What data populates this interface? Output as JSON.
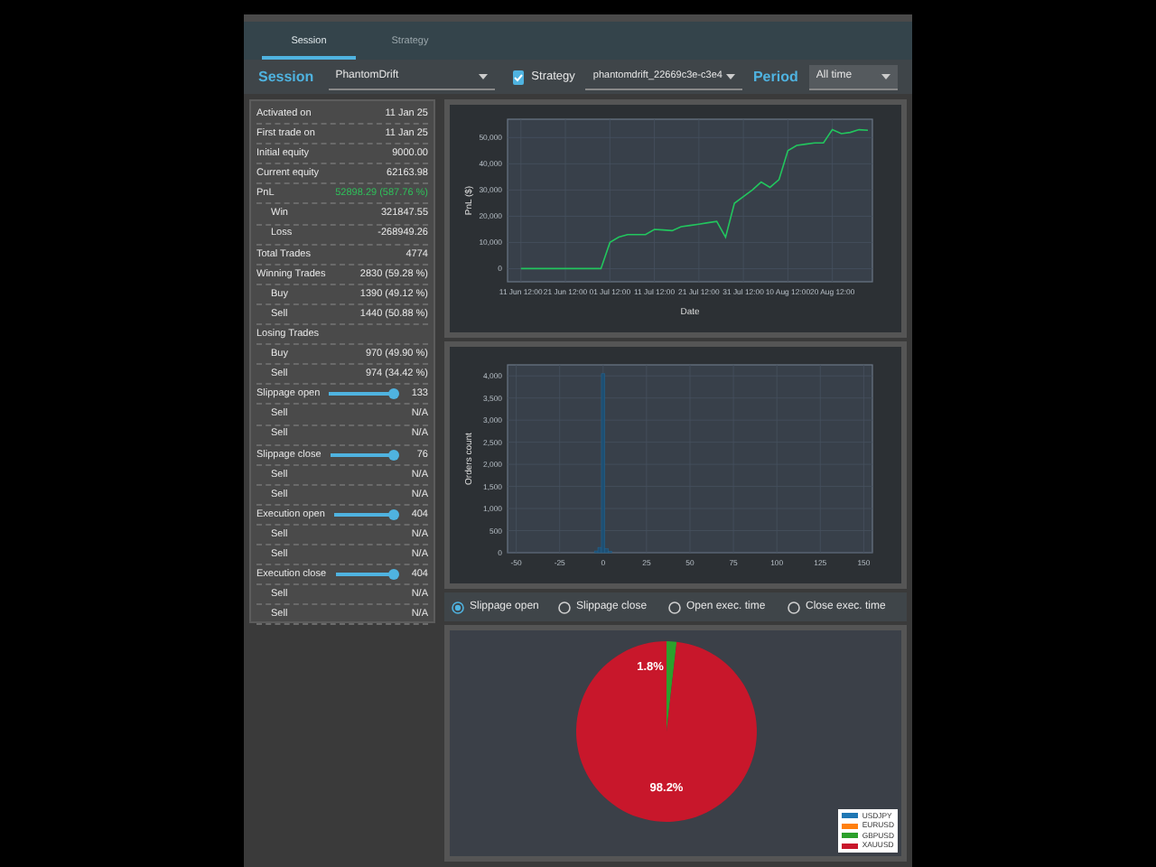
{
  "tabs": [
    {
      "label": "Session",
      "selected": true
    },
    {
      "label": "Strategy",
      "selected": false
    }
  ],
  "toolbar": {
    "session_label": "Session",
    "session_value": "PhantomDrift",
    "strategy_checked": true,
    "strategy_label": "Strategy",
    "strategy_value": "phantomdrift_22669c3e-c3e4",
    "period_label": "Period",
    "period_value": "All time"
  },
  "stats": [
    {
      "kind": "stat",
      "label": "Activated on",
      "value": "11 Jan 25"
    },
    {
      "kind": "stat",
      "label": "First trade on",
      "value": "11 Jan 25"
    },
    {
      "kind": "stat",
      "label": "Initial equity",
      "value": "9000.00"
    },
    {
      "kind": "stat",
      "label": "Current equity",
      "value": "62163.98"
    },
    {
      "kind": "gain",
      "label": "PnL",
      "value": "52898.29 (587.76 %)"
    },
    {
      "kind": "sub",
      "label": "Win",
      "value": "321847.55"
    },
    {
      "kind": "sub",
      "label": "Loss",
      "value": "-268949.26"
    },
    {
      "kind": "stat",
      "label": "Total Trades",
      "value": "4774"
    },
    {
      "kind": "stat",
      "label": "Winning Trades",
      "value": "2830 (59.28 %)"
    },
    {
      "kind": "sub",
      "label": "Buy",
      "value": "1390 (49.12 %)"
    },
    {
      "kind": "sub",
      "label": "Sell",
      "value": "1440 (50.88 %)"
    },
    {
      "kind": "stat",
      "label": "Losing Trades"
    },
    {
      "kind": "sub",
      "label": "Buy",
      "value": "970 (49.90 %)"
    },
    {
      "kind": "sub",
      "label": "Sell",
      "value": "974 (34.42 %)"
    },
    {
      "kind": "slider",
      "label": "Slippage open",
      "level": 0.95,
      "reading": "133"
    },
    {
      "kind": "sub",
      "label": "Sell",
      "value": "N/A"
    },
    {
      "kind": "sub",
      "label": "Sell",
      "value": "N/A"
    },
    {
      "kind": "slider",
      "label": "Slippage close",
      "level": 0.95,
      "reading": "76"
    },
    {
      "kind": "sub",
      "label": "Sell",
      "value": "N/A"
    },
    {
      "kind": "sub",
      "label": "Sell",
      "value": "N/A"
    },
    {
      "kind": "slider",
      "label": "Execution open",
      "level": 0.95,
      "reading": "404"
    },
    {
      "kind": "sub",
      "label": "Sell",
      "value": "N/A"
    },
    {
      "kind": "sub",
      "label": "Sell",
      "value": "N/A"
    },
    {
      "kind": "slider",
      "label": "Execution close",
      "level": 0.95,
      "reading": "404"
    },
    {
      "kind": "sub",
      "label": "Sell",
      "value": "N/A"
    },
    {
      "kind": "sub",
      "label": "Sell",
      "value": "N/A"
    }
  ],
  "pnl_chart": {
    "chart_data": {
      "type": "line",
      "xlabel": "Date",
      "ylabel": "PnL ($)",
      "grid": true,
      "ylim": [
        -5000,
        57000
      ],
      "categories": [
        "11 Jun 12:00",
        null,
        null,
        null,
        null,
        "21 Jun 12:00",
        null,
        null,
        null,
        null,
        "01 Jul 12:00",
        null,
        null,
        null,
        null,
        "11 Jul 12:00",
        null,
        null,
        null,
        null,
        "21 Jul 12:00",
        null,
        null,
        null,
        null,
        "31 Jul 12:00",
        null,
        null,
        null,
        null,
        "10 Aug 12:00",
        null,
        null,
        null,
        null,
        "20 Aug 12:00",
        null,
        null,
        null,
        null
      ],
      "series": [
        {
          "color": "#22c55e",
          "values": [
            0,
            0,
            0,
            0,
            0,
            0,
            0,
            0,
            0,
            0,
            10000,
            12000,
            13000,
            13000,
            13000,
            15000,
            14800,
            14500,
            16000,
            16500,
            17000,
            17500,
            18000,
            12000,
            25000,
            27500,
            30000,
            33000,
            31000,
            34000,
            45000,
            47000,
            47500,
            48000,
            48000,
            53000,
            51500,
            52000,
            53000,
            52800
          ]
        }
      ],
      "yticks": [
        {
          "value": 0,
          "label": "0"
        },
        {
          "value": 10000,
          "label": "10,000"
        },
        {
          "value": 20000,
          "label": "20,000"
        },
        {
          "value": 30000,
          "label": "30,000"
        },
        {
          "value": 40000,
          "label": "40,000"
        },
        {
          "value": 50000,
          "label": "50,000"
        }
      ]
    }
  },
  "histogram": {
    "chart_data": {
      "type": "bar",
      "ylabel": "Orders count",
      "grid": true,
      "xlim": [
        -55,
        155
      ],
      "ylim": [
        0,
        4250
      ],
      "x": [
        -4,
        -2,
        0,
        2,
        4
      ],
      "series": [
        {
          "color": "#1e4f73",
          "values": [
            40,
            120,
            4050,
            90,
            30
          ]
        }
      ],
      "xticks": [
        {
          "value": -50,
          "label": "-50"
        },
        {
          "value": -25,
          "label": "-25"
        },
        {
          "value": 0,
          "label": "0"
        },
        {
          "value": 25,
          "label": "25"
        },
        {
          "value": 50,
          "label": "50"
        },
        {
          "value": 75,
          "label": "75"
        },
        {
          "value": 100,
          "label": "100"
        },
        {
          "value": 125,
          "label": "125"
        },
        {
          "value": 150,
          "label": "150"
        }
      ],
      "yticks": [
        {
          "value": 0,
          "label": "0"
        },
        {
          "value": 500,
          "label": "500"
        },
        {
          "value": 1000,
          "label": "1,000"
        },
        {
          "value": 1500,
          "label": "1,500"
        },
        {
          "value": 2000,
          "label": "2,000"
        },
        {
          "value": 2500,
          "label": "2,500"
        },
        {
          "value": 3000,
          "label": "3,000"
        },
        {
          "value": 3500,
          "label": "3,500"
        },
        {
          "value": 4000,
          "label": "4,000"
        }
      ]
    }
  },
  "metric_options": [
    {
      "label": "Slippage open",
      "selected": true
    },
    {
      "label": "Slippage close",
      "selected": false
    },
    {
      "label": "Open exec. time",
      "selected": false
    },
    {
      "label": "Close exec. time",
      "selected": false
    }
  ],
  "symbols_chart": {
    "chart_data": {
      "type": "pie",
      "categories": [
        "USDJPY",
        "EURUSD",
        "GBPUSD",
        "XAUUSD"
      ],
      "colors": [
        "#1f77b4",
        "#ff7f0e",
        "#2ca02c",
        "#c8172b"
      ],
      "legend": true,
      "series": [
        {
          "values": [
            0,
            0,
            1.8,
            98.2
          ]
        }
      ],
      "value_labels": [
        null,
        null,
        "1.8%",
        "98.2%"
      ]
    }
  }
}
